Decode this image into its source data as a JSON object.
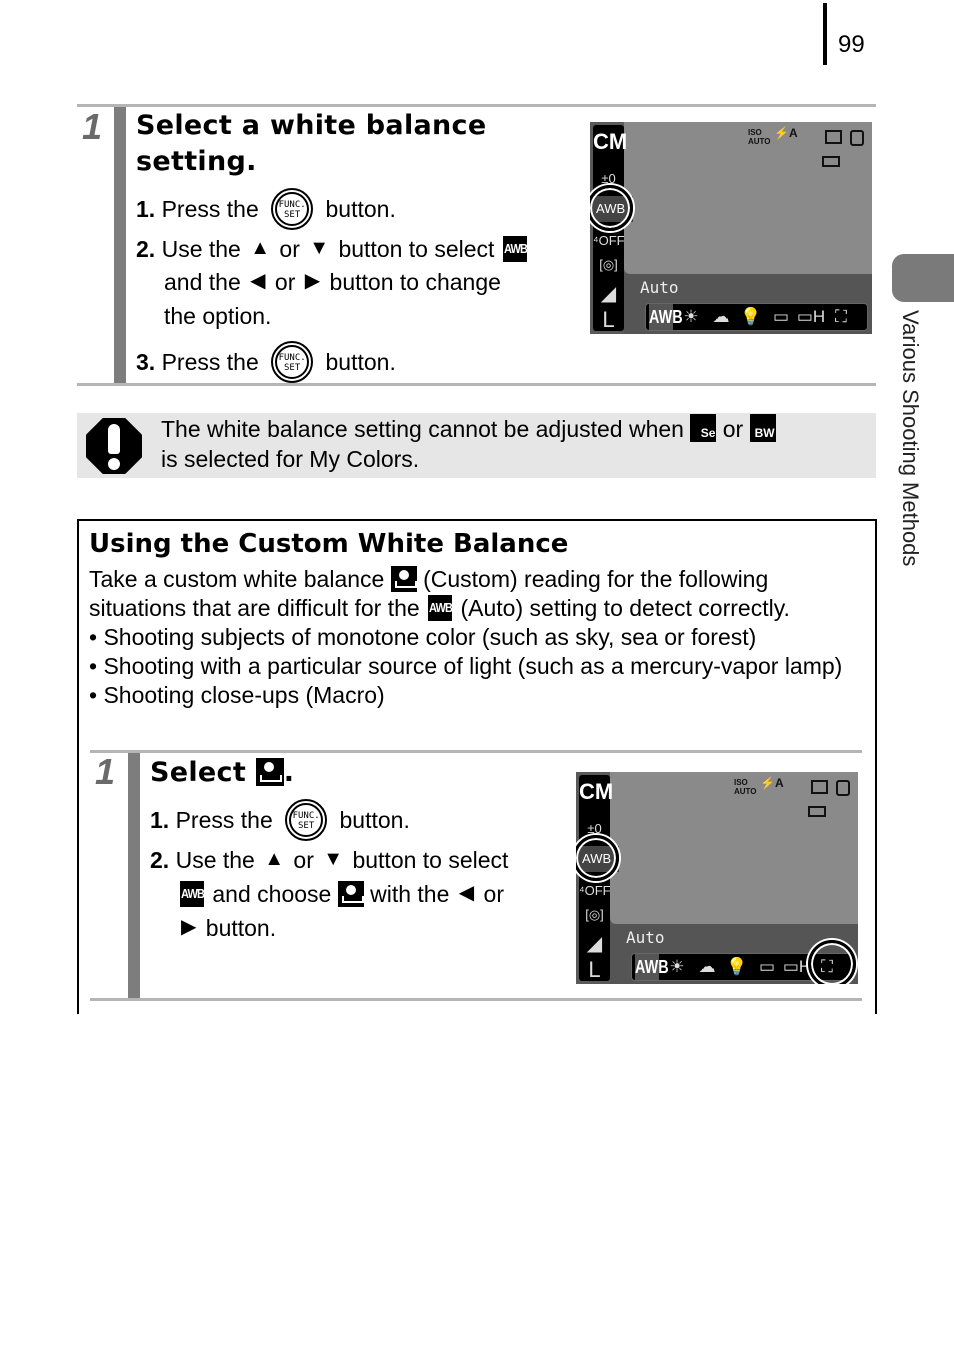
{
  "page": {
    "number": "99",
    "section_tab": "Various Shooting Methods"
  },
  "step1": {
    "number": "1",
    "title_line1": "Select a white balance",
    "title_line2": "setting.",
    "items": [
      {
        "num": "1.",
        "pre": "Press the",
        "post": "button."
      },
      {
        "num": "2.",
        "line1_pre": "Use the",
        "or": "or",
        "line1_post": "button to select",
        "line2_pre": "and the",
        "line2_post": "button to change",
        "line3": "the option."
      },
      {
        "num": "3.",
        "pre": "Press the",
        "post": "button."
      }
    ]
  },
  "icons": {
    "func_line1": "FUNC.",
    "func_line2": "SET",
    "awb": "AWB",
    "up_arrow": "▲",
    "down_arrow": "▼",
    "left_arrow": "◀",
    "right_arrow": "▶",
    "sepia_label": "Se",
    "bw_label": "BW"
  },
  "camera_screen": {
    "mode": "CM",
    "exposure": "±0",
    "wb_selected": "AWB",
    "flash_off": "⁴OFF",
    "metering": "[◎]",
    "quality": "◢",
    "size": "L",
    "iso": "ISO AUTO",
    "flash": "⚡A",
    "label": "Auto",
    "wb_options": [
      "AWB",
      "☀",
      "☁",
      "💡",
      "▭",
      "▭H",
      "⛶"
    ]
  },
  "caution": {
    "line1_pre": "The white balance setting cannot be adjusted when",
    "or": "or",
    "line2": "is selected for My Colors."
  },
  "custom_wb": {
    "title": "Using the Custom White Balance",
    "intro_line1_pre": "Take a custom white balance",
    "intro_line1_post": "(Custom) reading for the following",
    "intro_line2_pre": "situations that are difficult for the",
    "intro_line2_post": "(Auto) setting to detect correctly.",
    "bullets": [
      "Shooting subjects of monotone color (such as sky, sea or forest)",
      "Shooting with a particular source of light (such as a mercury-vapor lamp)",
      "Shooting close-ups (Macro)"
    ],
    "bullet_mark": "•",
    "step": {
      "number": "1",
      "title": "Select",
      "title_end": ".",
      "item1_num": "1.",
      "item1_pre": "Press the",
      "item1_post": "button.",
      "item2_num": "2.",
      "item2_line1_pre": "Use the",
      "item2_or": "or",
      "item2_line1_post": "button to select",
      "item2_line2_mid": "and choose",
      "item2_line2_post": "with the",
      "item2_line2_or": "or",
      "item2_line3": "button."
    }
  }
}
